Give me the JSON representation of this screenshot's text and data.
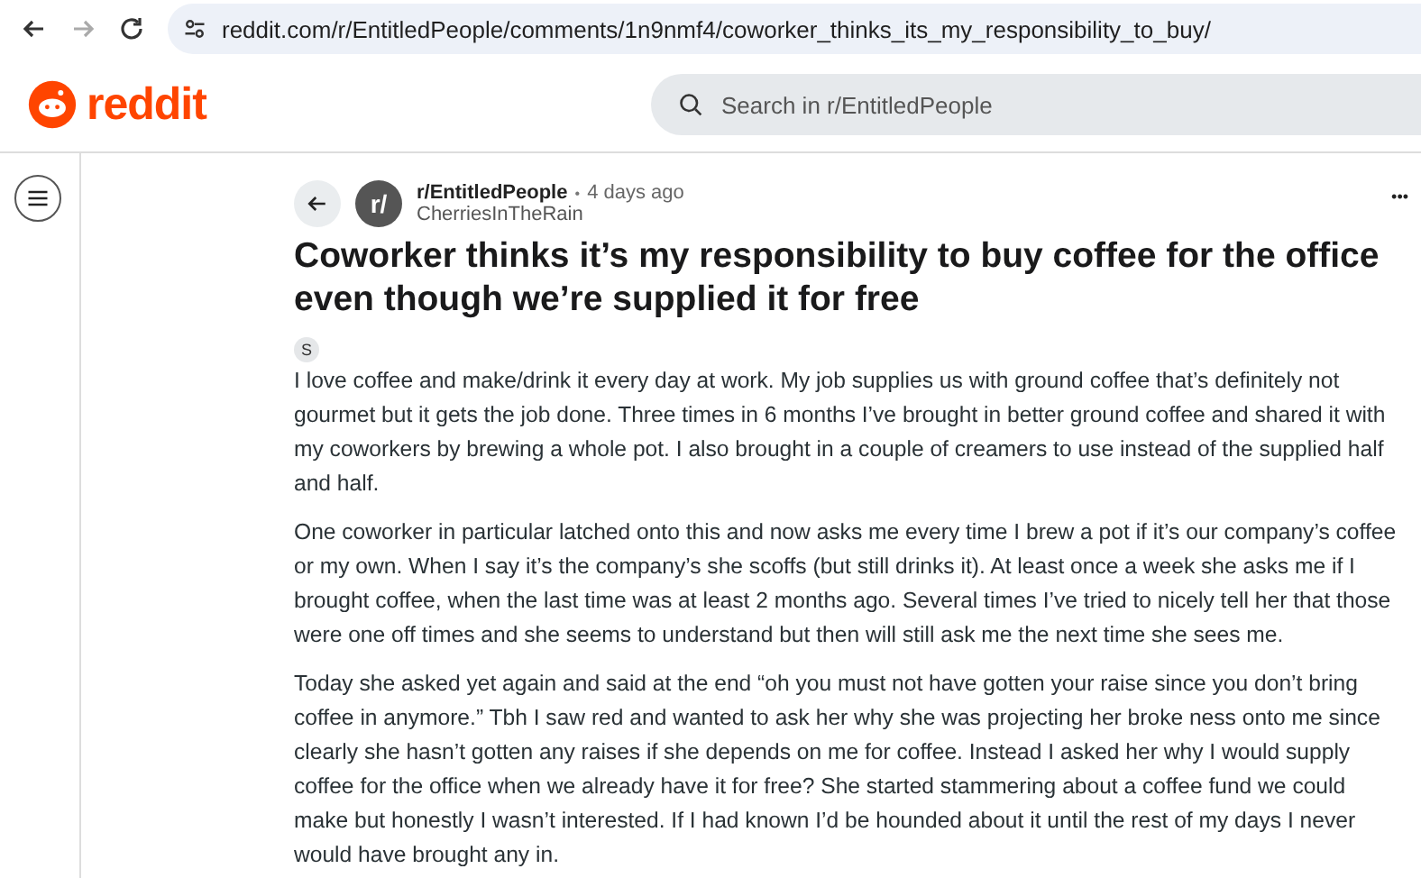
{
  "browser": {
    "url": "reddit.com/r/EntitledPeople/comments/1n9nmf4/coworker_thinks_its_my_responsibility_to_buy/"
  },
  "header": {
    "logo_text": "reddit",
    "search": {
      "placeholder": "Search in r/EntitledPeople"
    }
  },
  "post": {
    "subreddit": "r/EntitledPeople",
    "subreddit_icon": "r/",
    "separator": "•",
    "time": "4 days ago",
    "author": "CherriesInTheRain",
    "more": "•••",
    "title": "Coworker thinks it’s my responsibility to buy coffee for the office even though we’re supplied it for free",
    "flair": "S",
    "paragraphs": [
      "I love coffee and make/drink it every day at work. My job supplies us with ground coffee that’s definitely not gourmet but it gets the job done. Three times in 6 months I’ve brought in better ground coffee and shared it with my coworkers by brewing a whole pot. I also brought in a couple of creamers to use instead of the supplied half and half.",
      "One coworker in particular latched onto this and now asks me every time I brew a pot if it’s our company’s coffee or my own. When I say it’s the company’s she scoffs (but still drinks it). At least once a week she asks me if I brought coffee, when the last time was at least 2 months ago. Several times I’ve tried to nicely tell her that those were one off times and she seems to understand but then will still ask me the next time she sees me.",
      "Today she asked yet again and said at the end “oh you must not have gotten your raise since you don’t bring coffee in anymore.” Tbh I saw red and wanted to ask her why she was projecting her broke ness onto me since clearly she hasn’t gotten any raises if she depends on me for coffee. Instead I asked her why I would supply coffee for the office when we already have it for free? She started stammering about a coffee fund we could make but honestly I wasn’t interested. If I had known I’d be hounded about it until the rest of my days I never would have brought any in."
    ]
  }
}
